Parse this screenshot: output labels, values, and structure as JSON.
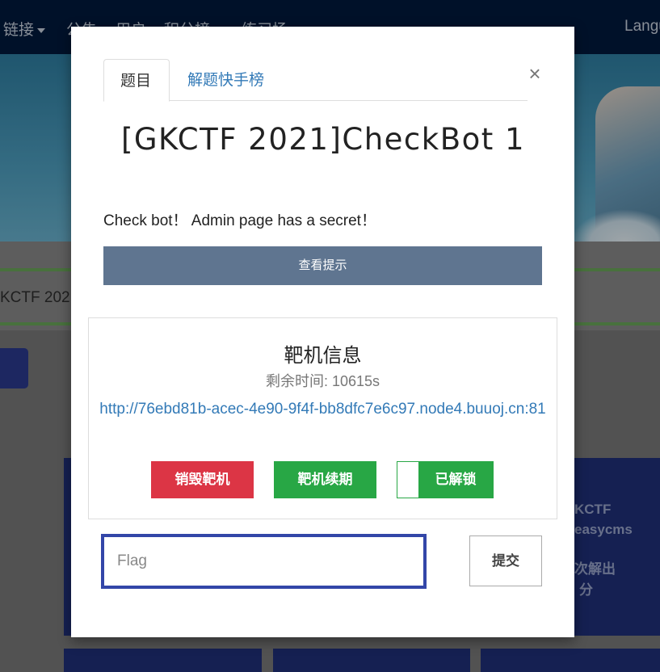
{
  "navbar": {
    "items": [
      {
        "label": "链接"
      },
      {
        "label": "公告"
      },
      {
        "label": "用户"
      },
      {
        "label": "积分榜"
      },
      {
        "label": "练习场"
      }
    ],
    "language_label": "Langu"
  },
  "background": {
    "breadcrumb_text": "KCTF 202",
    "card_text": [
      "KCTF",
      "easycms",
      "次解出",
      "分"
    ]
  },
  "modal": {
    "tabs": [
      {
        "label": "题目"
      },
      {
        "label": "解题快手榜"
      }
    ],
    "close_label": "×",
    "title": "[GKCTF 2021]CheckBot 1",
    "description": "Check bot！ Admin page has a secret！",
    "hint_button": "查看提示",
    "target": {
      "heading": "靶机信息",
      "time_label": "剩余时间: ",
      "time_value": "10615s",
      "url": "http://76ebd81b-acec-4e90-9f4f-bb8dfc7e6c97.node4.buuoj.cn:81",
      "destroy_button": "销毁靶机",
      "renew_button": "靶机续期",
      "unlock_label": "已解锁"
    },
    "flag_input": {
      "placeholder": "Flag",
      "value": ""
    },
    "submit_button": "提交"
  },
  "colors": {
    "navbar_bg": "#011a3d",
    "hint_button_bg": "#5f7590",
    "destroy_bg": "#dc3545",
    "renew_bg": "#28a745",
    "link": "#337ab7",
    "input_border": "#3346a8"
  }
}
